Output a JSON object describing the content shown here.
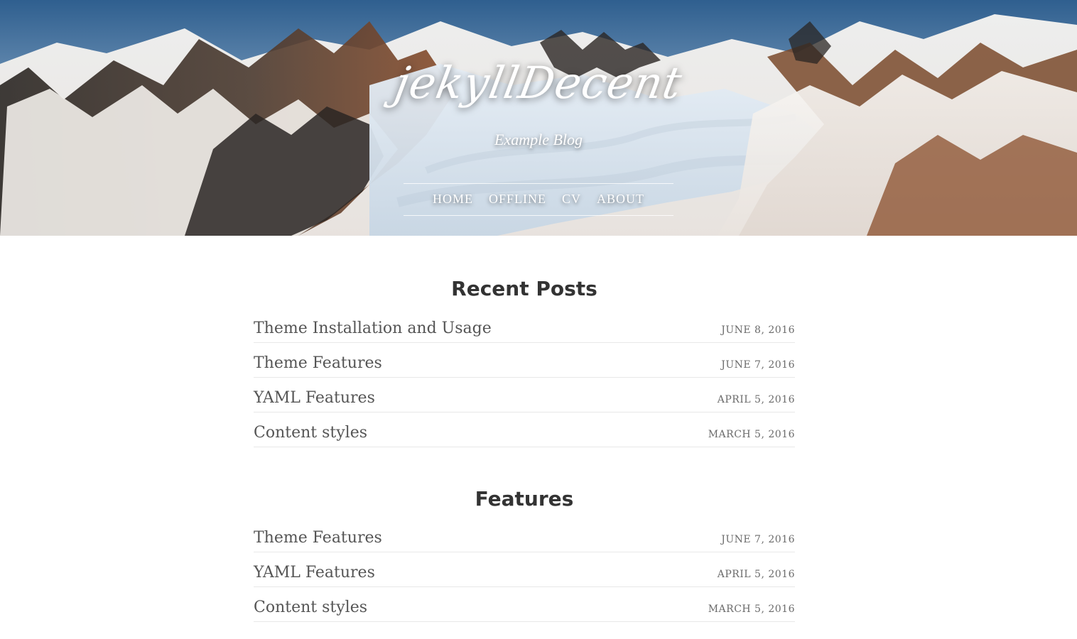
{
  "hero": {
    "title": "jekyllDecent",
    "tagline": "Example Blog",
    "nav": [
      {
        "label": "HOME"
      },
      {
        "label": "OFFLINE"
      },
      {
        "label": "CV"
      },
      {
        "label": "ABOUT"
      }
    ],
    "background": {
      "sky_top": "#2f5f8f",
      "sky_mid": "#7fa0c0",
      "snow": "#f4f1ee",
      "rock_dark": "#2a2623",
      "rock_warm": "#8a4d2b",
      "ice": "#d8e4ee"
    }
  },
  "sections": [
    {
      "title": "Recent Posts",
      "posts": [
        {
          "title": "Theme Installation and Usage",
          "date": "JUNE 8, 2016"
        },
        {
          "title": "Theme Features",
          "date": "JUNE 7, 2016"
        },
        {
          "title": "YAML Features",
          "date": "APRIL 5, 2016"
        },
        {
          "title": "Content styles",
          "date": "MARCH 5, 2016"
        }
      ]
    },
    {
      "title": "Features",
      "posts": [
        {
          "title": "Theme Features",
          "date": "JUNE 7, 2016"
        },
        {
          "title": "YAML Features",
          "date": "APRIL 5, 2016"
        },
        {
          "title": "Content styles",
          "date": "MARCH 5, 2016"
        }
      ]
    }
  ]
}
